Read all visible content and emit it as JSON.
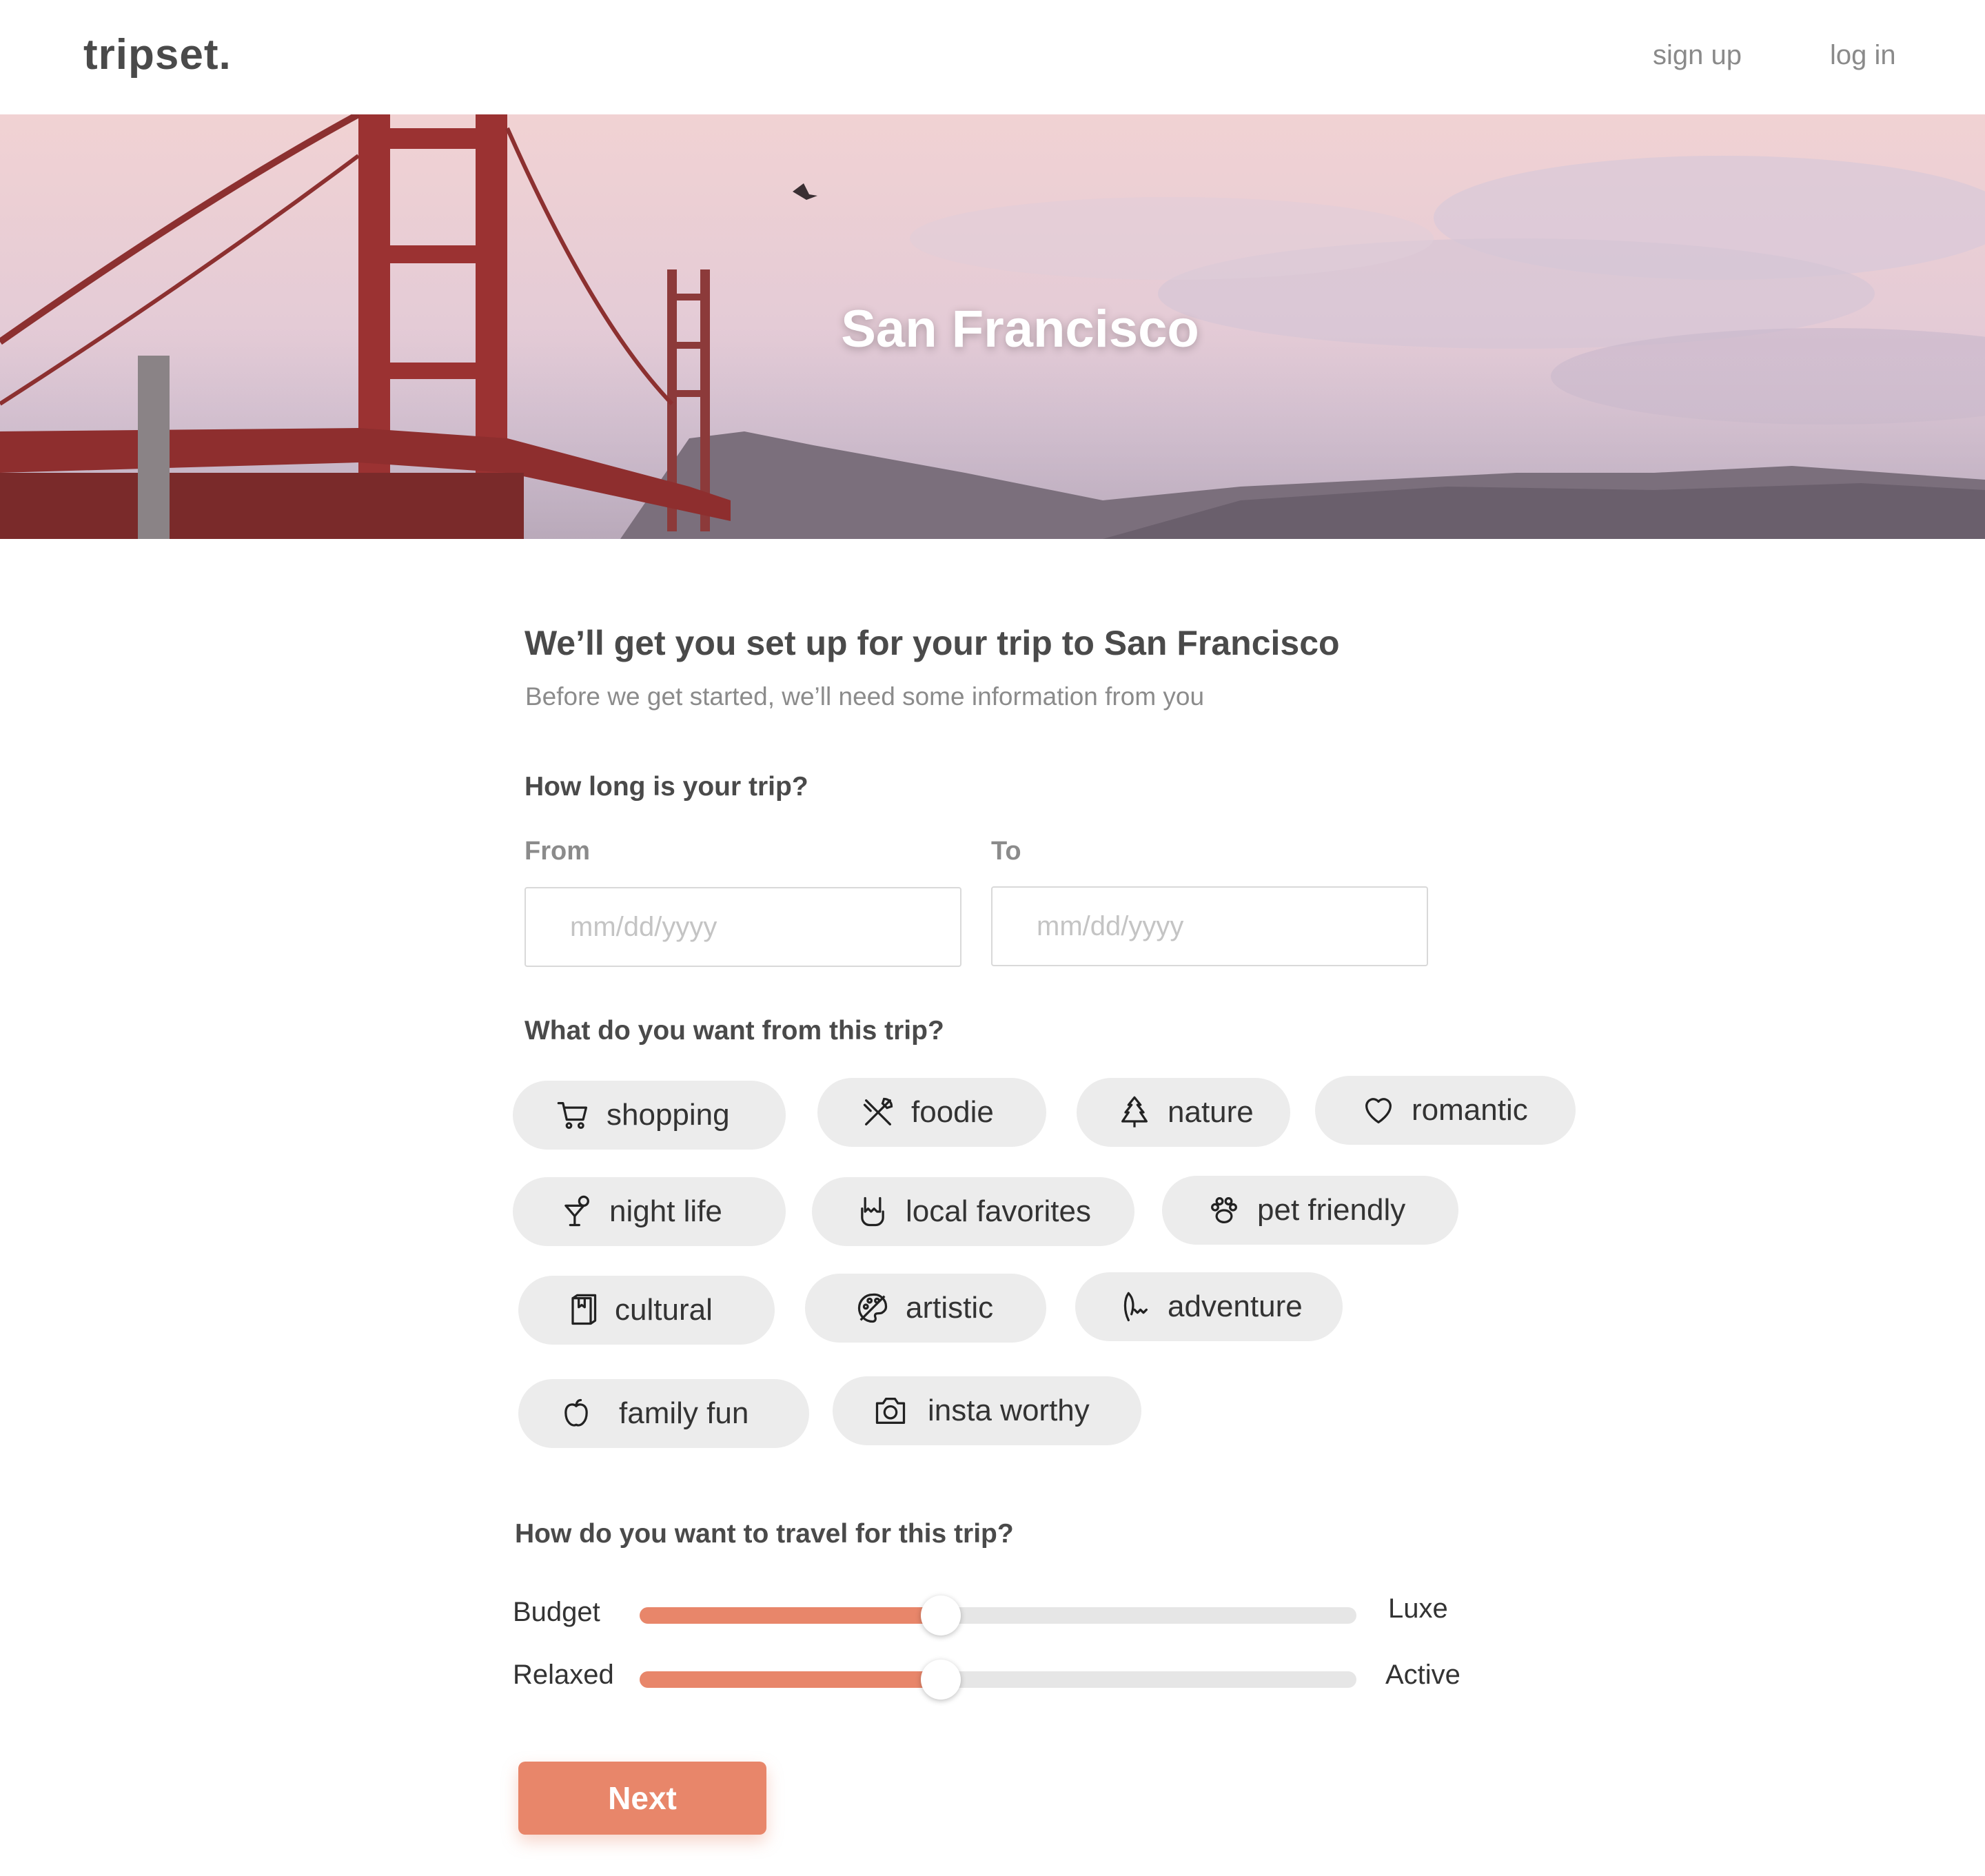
{
  "header": {
    "logo": "tripset.",
    "nav": {
      "signup": "sign up",
      "login": "log in"
    }
  },
  "hero": {
    "title": "San Francisco"
  },
  "intro": {
    "title": "We’ll get you set up for your trip to San Francisco",
    "subtitle": "Before we get started, we’ll need some information from you"
  },
  "trip_length": {
    "question": "How long is your trip?",
    "from_label": "From",
    "to_label": "To",
    "from_placeholder": "mm/dd/yyyy",
    "to_placeholder": "mm/dd/yyyy"
  },
  "interests": {
    "question": "What do you want from this trip?",
    "items": [
      {
        "label": "shopping",
        "icon": "cart-icon"
      },
      {
        "label": "foodie",
        "icon": "utensils-icon"
      },
      {
        "label": "nature",
        "icon": "tree-icon"
      },
      {
        "label": "romantic",
        "icon": "heart-icon"
      },
      {
        "label": "night life",
        "icon": "cocktail-icon"
      },
      {
        "label": "local favorites",
        "icon": "rock-hand-icon"
      },
      {
        "label": "pet friendly",
        "icon": "paw-icon"
      },
      {
        "label": "cultural",
        "icon": "book-icon"
      },
      {
        "label": "artistic",
        "icon": "palette-icon"
      },
      {
        "label": "adventure",
        "icon": "hiking-icon"
      },
      {
        "label": "family fun",
        "icon": "apple-icon"
      },
      {
        "label": "insta worthy",
        "icon": "camera-icon"
      }
    ]
  },
  "travel_style": {
    "question": "How do you want to travel for this trip?",
    "sliders": [
      {
        "left": "Budget",
        "right": "Luxe",
        "value": 0.42
      },
      {
        "left": "Relaxed",
        "right": "Active",
        "value": 0.42
      }
    ]
  },
  "actions": {
    "next": "Next"
  },
  "colors": {
    "accent": "#e8866a",
    "chip_bg": "#ececec",
    "text": "#4a4a4a",
    "muted": "#8b8b8b"
  }
}
